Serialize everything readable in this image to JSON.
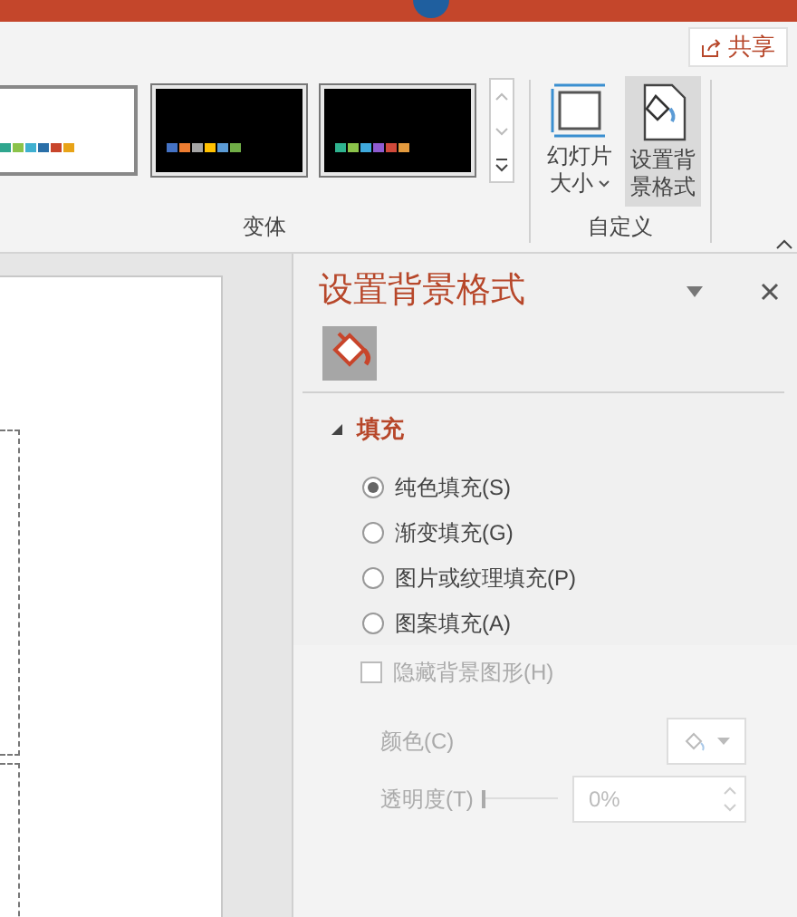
{
  "share_button": {
    "label": "共享"
  },
  "variants": {
    "label": "变体",
    "thumbnails": [
      {
        "kind": "light"
      },
      {
        "kind": "dark"
      },
      {
        "kind": "dark"
      }
    ]
  },
  "customize": {
    "label": "自定义",
    "buttons": [
      {
        "kind": "size",
        "lines": [
          "幻灯片",
          "大小"
        ],
        "dropdown": true,
        "selected": false
      },
      {
        "kind": "background",
        "lines": [
          "设置背",
          "景格式"
        ],
        "dropdown": false,
        "selected": true
      }
    ]
  },
  "pane": {
    "title": "设置背景格式",
    "section": {
      "label": "填充",
      "expanded": true
    },
    "options": [
      {
        "label": "纯色填充(S)",
        "selected": true
      },
      {
        "label": "渐变填充(G)",
        "selected": false
      },
      {
        "label": "图片或纹理填充(P)",
        "selected": false
      },
      {
        "label": "图案填充(A)",
        "selected": false
      }
    ],
    "hide_graphics": {
      "label": "隐藏背景图形(H)",
      "checked": false,
      "disabled": true
    },
    "color": {
      "label": "颜色(C)"
    },
    "transparency": {
      "label": "透明度(T)",
      "value": "0%",
      "level": 0
    }
  }
}
